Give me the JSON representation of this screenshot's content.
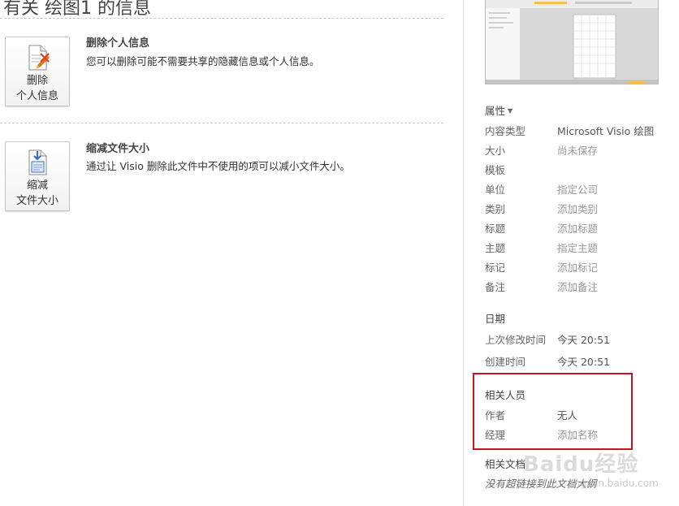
{
  "page": {
    "title": "有关 绘图1 的信息"
  },
  "sections": [
    {
      "button_line1": "删除",
      "button_line2": "个人信息",
      "title": "删除个人信息",
      "description": "您可以删除可能不需要共享的隐藏信息或个人信息。",
      "icon": "document-delete-icon"
    },
    {
      "button_line1": "缩减",
      "button_line2": "文件大小",
      "title": "缩减文件大小",
      "description": "通过让 Visio 删除此文件中不使用的项可以减小文件大小。",
      "icon": "document-compress-icon"
    }
  ],
  "properties": {
    "header": "属性",
    "rows": [
      {
        "label": "内容类型",
        "value": "Microsoft Visio 绘图"
      },
      {
        "label": "大小",
        "value": "尚未保存"
      },
      {
        "label": "模板",
        "value": ""
      },
      {
        "label": "单位",
        "value": "指定公司"
      },
      {
        "label": "类别",
        "value": "添加类别"
      },
      {
        "label": "标题",
        "value": "添加标题"
      },
      {
        "label": "主题",
        "value": "指定主题"
      },
      {
        "label": "标记",
        "value": "添加标记"
      },
      {
        "label": "备注",
        "value": "添加备注"
      }
    ]
  },
  "dates": {
    "header": "日期",
    "rows": [
      {
        "label": "上次修改时间",
        "value": "今天 20:51"
      },
      {
        "label": "创建时间",
        "value": "今天 20:51"
      }
    ]
  },
  "people": {
    "header": "相关人员",
    "rows": [
      {
        "label": "作者",
        "value": "无人"
      },
      {
        "label": "经理",
        "value": "添加名称"
      }
    ]
  },
  "related_docs": {
    "header": "相关文档",
    "note": "没有超链接到此文档大纲"
  },
  "watermark": {
    "text": "Baidu经验",
    "sub": "jingyan.baidu.com"
  },
  "colors": {
    "highlight": "#c8141e",
    "icon_accent": "#e8741a",
    "icon_blue": "#3a6fc4"
  }
}
